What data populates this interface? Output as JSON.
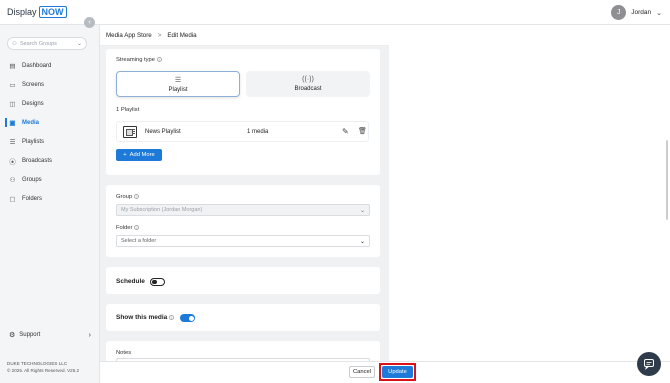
{
  "brand": {
    "name_part1": "Display",
    "name_part2": "NOW"
  },
  "user": {
    "initial": "J",
    "name": "Jordan"
  },
  "sidebar": {
    "search_placeholder": "Search Groups",
    "items": [
      {
        "label": "Dashboard",
        "icon": "dashboard-icon",
        "active": false
      },
      {
        "label": "Screens",
        "icon": "screen-icon",
        "active": false
      },
      {
        "label": "Designs",
        "icon": "design-icon",
        "active": false
      },
      {
        "label": "Media",
        "icon": "media-icon",
        "active": true
      },
      {
        "label": "Playlists",
        "icon": "playlist-icon",
        "active": false
      },
      {
        "label": "Broadcasts",
        "icon": "broadcast-icon",
        "active": false
      },
      {
        "label": "Groups",
        "icon": "groups-icon",
        "active": false
      },
      {
        "label": "Folders",
        "icon": "folder-icon",
        "active": false
      }
    ],
    "support_label": "Support",
    "company_line1": "DUKE TECHNOLOGIES LLC",
    "company_line2": "© 2025. All Rights Reserved. V25.2"
  },
  "breadcrumb": {
    "parent": "Media App Store",
    "separator": ">",
    "current": "Edit Media"
  },
  "streaming": {
    "label": "Streaming type",
    "options": [
      {
        "label": "Playlist",
        "selected": true
      },
      {
        "label": "Broadcast",
        "selected": false
      }
    ]
  },
  "playlists": {
    "count_label": "1 Playlist",
    "items": [
      {
        "name": "News Playlist",
        "count": "1 media"
      }
    ],
    "add_label": "Add More"
  },
  "group": {
    "label": "Group",
    "value": "My Subscription (Jordan Morgan)"
  },
  "folder": {
    "label": "Folder",
    "placeholder": "Select a folder"
  },
  "schedule": {
    "label": "Schedule",
    "enabled": false
  },
  "show_media": {
    "label": "Show this media",
    "enabled": true
  },
  "notes": {
    "label": "Notes"
  },
  "footer": {
    "cancel_label": "Cancel",
    "update_label": "Update"
  },
  "colors": {
    "accent": "#1e7ad8",
    "highlight": "#d9121b"
  }
}
